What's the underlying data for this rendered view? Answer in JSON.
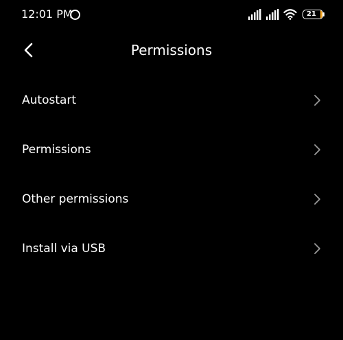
{
  "status_bar": {
    "time": "12:01 PM",
    "battery_level": "21",
    "icons": [
      "ring-icon",
      "signal-icon",
      "signal-icon",
      "wifi-icon",
      "battery-icon"
    ]
  },
  "header": {
    "title": "Permissions",
    "back_icon": "chevron-left-icon"
  },
  "menu": {
    "items": [
      {
        "label": "Autostart"
      },
      {
        "label": "Permissions"
      },
      {
        "label": "Other permissions"
      },
      {
        "label": "Install via USB"
      }
    ],
    "chevron_icon": "chevron-right-icon"
  },
  "colors": {
    "background": "#000000",
    "text": "#ffffff",
    "chevron": "#9a9a9a",
    "battery_accent": "#f5a623"
  }
}
